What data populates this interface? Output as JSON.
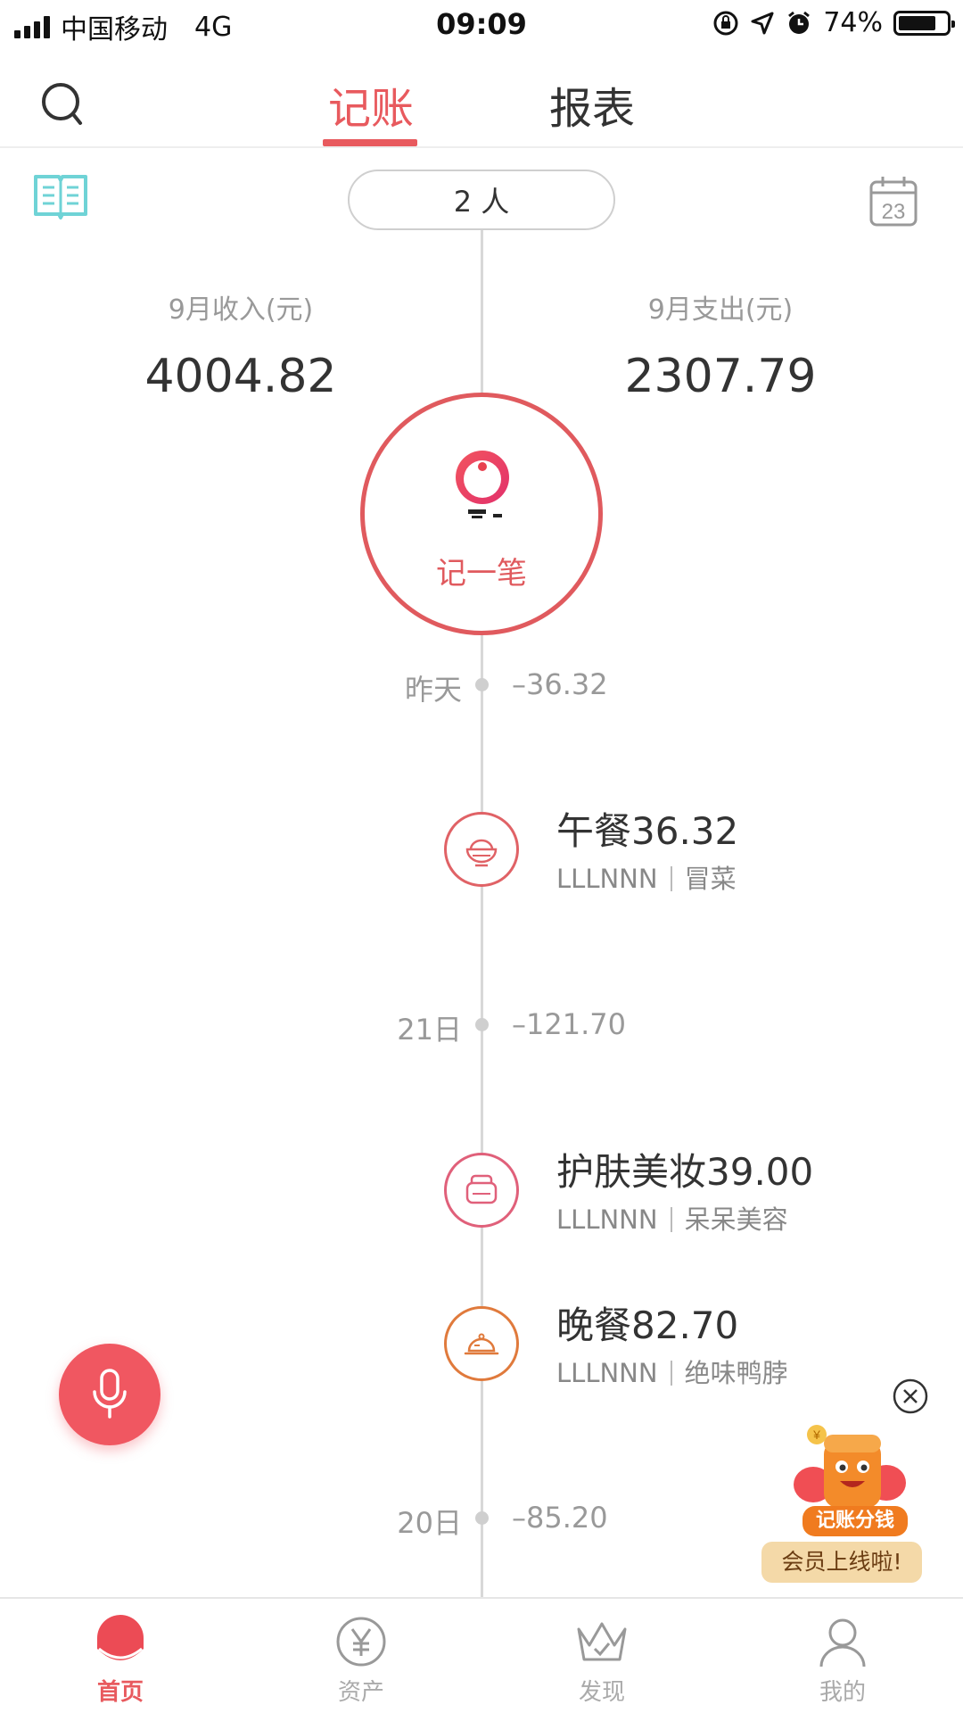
{
  "status_bar": {
    "carrier": "中国移动",
    "network": "4G",
    "time": "09:09",
    "battery": "74%"
  },
  "header": {
    "tabs": [
      {
        "label": "记账",
        "active": true
      },
      {
        "label": "报表",
        "active": false
      }
    ]
  },
  "toolbar": {
    "people_count": "2 人",
    "calendar_day": "23"
  },
  "summary": {
    "income_label": "9月收入(元)",
    "income_value": "4004.82",
    "expense_label": "9月支出(元)",
    "expense_value": "2307.79"
  },
  "record_button": {
    "label": "记一笔"
  },
  "timeline": {
    "days": [
      {
        "label": "昨天",
        "amount": "–36.32",
        "entries": [
          {
            "title": "午餐36.32",
            "user": "LLLNNN",
            "note": "冒菜",
            "icon": "rice-bowl-icon"
          }
        ]
      },
      {
        "label": "21日",
        "amount": "–121.70",
        "entries": [
          {
            "title": "护肤美妆39.00",
            "user": "LLLNNN",
            "note": "呆呆美容",
            "icon": "cosmetics-icon"
          },
          {
            "title": "晚餐82.70",
            "user": "LLLNNN",
            "note": "绝味鸭脖",
            "icon": "dinner-cloche-icon"
          }
        ]
      },
      {
        "label": "20日",
        "amount": "–85.20",
        "entries": []
      }
    ]
  },
  "promo": {
    "ribbon": "记账分钱",
    "badge": "会员上线啦!"
  },
  "bottom_nav": {
    "items": [
      {
        "label": "首页",
        "icon": "home-icon",
        "active": true
      },
      {
        "label": "资产",
        "icon": "yuan-icon",
        "active": false
      },
      {
        "label": "发现",
        "icon": "crown-icon",
        "active": false
      },
      {
        "label": "我的",
        "icon": "person-icon",
        "active": false
      }
    ]
  },
  "colors": {
    "accent": "#e85a5e",
    "muted": "#999999",
    "timeline": "#d8d8d8",
    "book_icon": "#6fd3d6",
    "dinner_icon": "#e07a3c"
  }
}
